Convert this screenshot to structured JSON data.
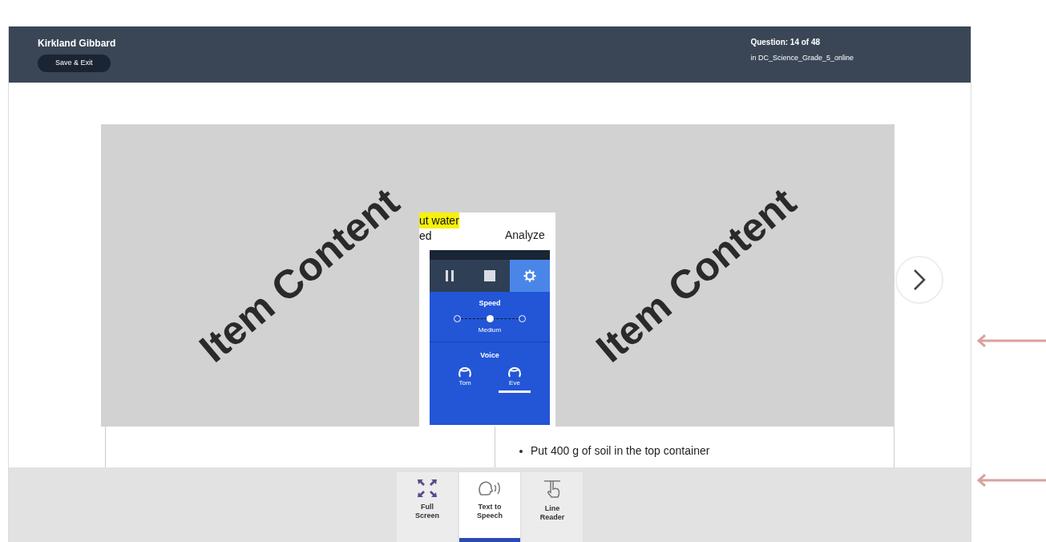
{
  "header": {
    "student_name": "Kirkland Gibbard",
    "save_button": "Save & Exit",
    "question": "Question: 14 of 48",
    "test_name": "in DC_Science_Grade_5_online"
  },
  "overlay": {
    "labels": [
      "Item Content",
      "Item Content"
    ]
  },
  "passage": {
    "highlighted": "ut water",
    "fragment": "ed",
    "heading": "Analyze",
    "bullet": "Put 400 g of soil in the top container"
  },
  "tts_panel": {
    "controls": [
      {
        "kind": "pause",
        "selected": false
      },
      {
        "kind": "stop",
        "selected": false
      },
      {
        "kind": "settings",
        "selected": true
      }
    ],
    "speed": {
      "label": "Speed",
      "level": 0.5,
      "reading": "Medium"
    },
    "voice": {
      "label": "Voice",
      "options": [
        {
          "label": "Tom",
          "selected": false
        },
        {
          "label": "Eve",
          "selected": true
        }
      ]
    }
  },
  "toolbar": [
    {
      "kind": "fullscreen",
      "label": "Full Screen",
      "selected": false
    },
    {
      "kind": "speech",
      "label": "Text to Speech",
      "selected": true
    },
    {
      "kind": "linereader",
      "label": "Line Reader",
      "selected": false
    }
  ]
}
